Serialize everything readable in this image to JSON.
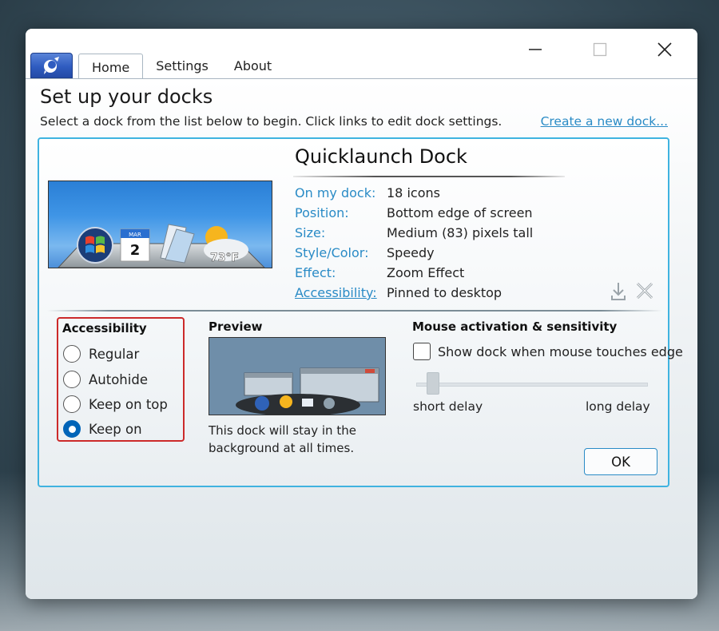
{
  "tabs": [
    {
      "label": "Home",
      "active": true
    },
    {
      "label": "Settings",
      "active": false
    },
    {
      "label": "About",
      "active": false
    }
  ],
  "page": {
    "title": "Set up your docks",
    "subtitle": "Select a dock from the list below to begin. Click links to edit dock settings.",
    "create_link": "Create a new dock..."
  },
  "dock": {
    "name": "Quicklaunch Dock",
    "thumb_weather": "73°F",
    "thumb_calendar_day": "2",
    "thumb_calendar_month": "MAR",
    "info": [
      {
        "label": "On my dock:",
        "value": "18 icons",
        "link": false
      },
      {
        "label": "Position:",
        "value": "Bottom edge of screen",
        "link": false
      },
      {
        "label": "Size:",
        "value": "Medium (83) pixels tall",
        "link": false
      },
      {
        "label": "Style/Color:",
        "value": "Speedy",
        "link": false
      },
      {
        "label": "Effect:",
        "value": "Zoom Effect",
        "link": false
      },
      {
        "label": "Accessibility:",
        "value": "Pinned to desktop",
        "link": true
      }
    ]
  },
  "accessibility": {
    "heading": "Accessibility",
    "options": [
      {
        "label": "Regular",
        "checked": false
      },
      {
        "label": "Autohide",
        "checked": false
      },
      {
        "label": "Keep on top",
        "checked": false
      },
      {
        "label": "Keep on",
        "checked": true
      }
    ]
  },
  "preview": {
    "heading": "Preview",
    "description": "This dock will stay in the background at all times."
  },
  "mouse": {
    "heading": "Mouse activation & sensitivity",
    "checkbox_label": "Show dock when mouse touches edge",
    "checkbox_checked": false,
    "slider_min_label": "short delay",
    "slider_max_label": "long delay",
    "slider_value": 0.05
  },
  "ok_label": "OK",
  "colors": {
    "accent": "#3fb3e0",
    "link": "#2a8bc6",
    "highlight_box": "#cc2a2a",
    "radio_selected": "#0064b8"
  }
}
